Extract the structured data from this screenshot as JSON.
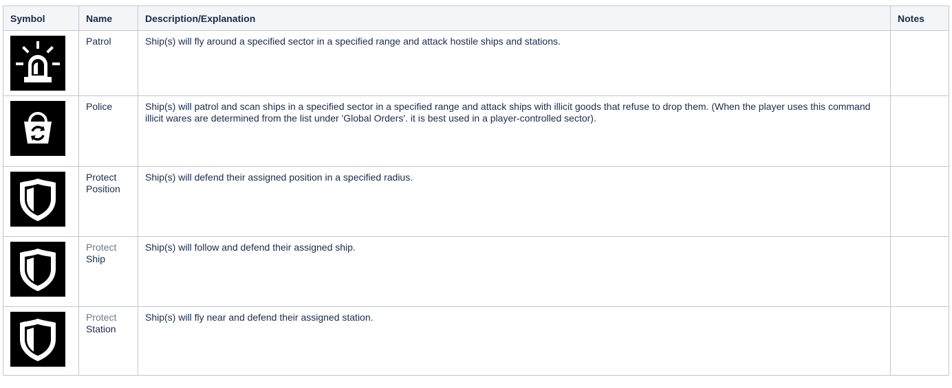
{
  "table": {
    "headers": {
      "symbol": "Symbol",
      "name": "Name",
      "description": "Description/Explanation",
      "notes": "Notes"
    },
    "rows": [
      {
        "icon": "siren-icon",
        "name_line1": "Patrol",
        "name_line2": "",
        "description": "Ship(s) will fly around a specified sector in a specified range and attack hostile ships and stations.",
        "notes": ""
      },
      {
        "icon": "police-basket-icon",
        "name_line1": "Police",
        "name_line2": "",
        "description": "Ship(s) will patrol and scan ships in a specified sector in a specified range and attack ships with illicit goods that refuse to drop them. (When the player uses this command illicit wares are determined from the list under 'Global Orders'. it is best used in a player-controlled sector).",
        "notes": ""
      },
      {
        "icon": "shield-icon",
        "name_line1": "Protect",
        "name_line2": "Position",
        "description": "Ship(s) will defend their assigned position in a specified radius.",
        "notes": ""
      },
      {
        "icon": "shield-icon",
        "name_line1": "Protect",
        "name_line2": "Ship",
        "description": "Ship(s) will follow and defend their assigned ship.",
        "notes": ""
      },
      {
        "icon": "shield-icon",
        "name_line1": "Protect",
        "name_line2": "Station",
        "description": "Ship(s) will fly near and defend their assigned station.",
        "notes": ""
      }
    ]
  },
  "colors": {
    "border": "#c1c7d0",
    "header_bg": "#f4f5f7",
    "text": "#172b4d",
    "muted_text": "#6b778c",
    "icon_bg": "#000000"
  }
}
